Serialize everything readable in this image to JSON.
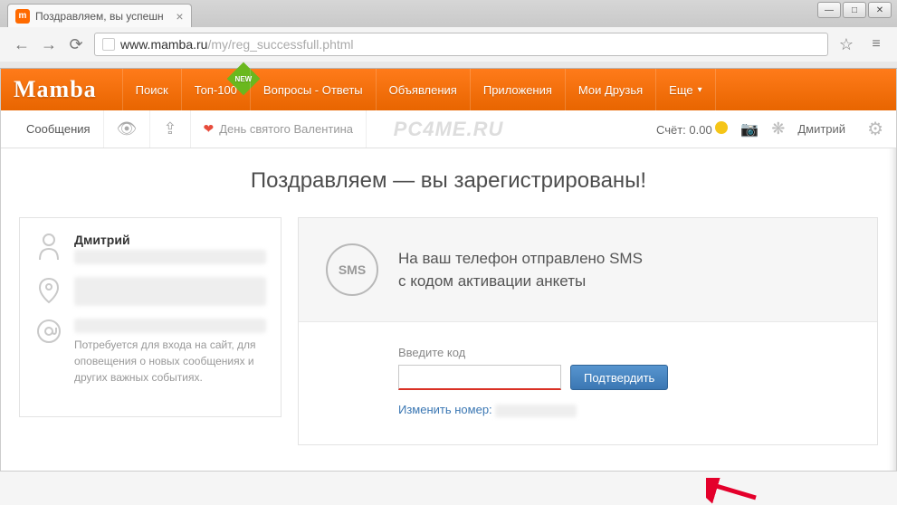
{
  "browser": {
    "tab_title": "Поздравляем, вы успешн",
    "url_host": "www.mamba.ru",
    "url_path": "/my/reg_successfull.phtml"
  },
  "header": {
    "logo": "Mamba",
    "nav": [
      "Поиск",
      "Топ-100",
      "Вопросы - Ответы",
      "Объявления",
      "Приложения",
      "Мои Друзья",
      "Еще"
    ],
    "new_badge": "NEW"
  },
  "subbar": {
    "messages": "Сообщения",
    "valentine": "День святого Валентина",
    "watermark": "PC4ME.RU",
    "balance_label": "Счёт:",
    "balance_value": "0.00",
    "username": "Дмитрий"
  },
  "title": "Поздравляем — вы зарегистрированы!",
  "sidebar": {
    "name": "Дмитрий",
    "note": "Потребуется для входа на сайт, для оповещения о новых сообщениях и других важных событиях."
  },
  "sms": {
    "badge": "SMS",
    "line1": "На ваш телефон отправлено SMS",
    "line2": "с кодом активации анкеты"
  },
  "form": {
    "label": "Введите код",
    "confirm": "Подтвердить",
    "change_label": "Изменить номер:"
  }
}
